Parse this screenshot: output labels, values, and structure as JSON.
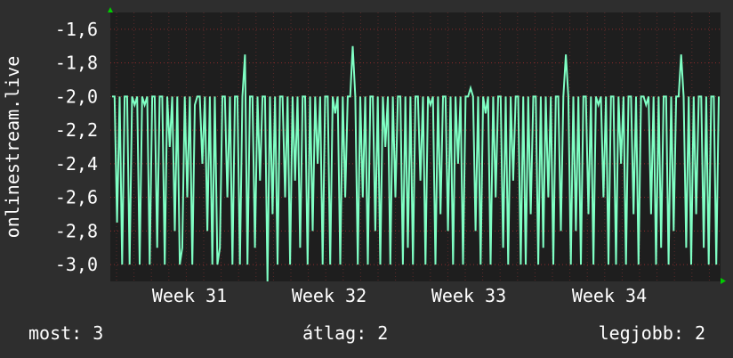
{
  "chart_data": {
    "type": "line",
    "ylabel": "onlinestream.live",
    "ylim": [
      -3.1,
      -1.5
    ],
    "yticks": [
      "-1,6",
      "-1,8",
      "-2,0",
      "-2,2",
      "-2,4",
      "-2,6",
      "-2,8",
      "-3,0"
    ],
    "ytick_values": [
      -1.6,
      -1.8,
      -2.0,
      -2.2,
      -2.4,
      -2.6,
      -2.8,
      -3.0
    ],
    "xticks": [
      "Week 31",
      "Week 32",
      "Week 33",
      "Week 34"
    ],
    "grid": true,
    "colors": {
      "background": "#2e2e2e",
      "plot": "#1e1e1e",
      "line": "#7fffc4",
      "grid": "#8b2b2b",
      "axis_arrow": "#00cc00"
    },
    "series": [
      {
        "values": [
          -2.0,
          -2.0,
          -2.75,
          -2.0,
          -3.0,
          -2.0,
          -2.0,
          -3.0,
          -2.0,
          -2.05,
          -2.0,
          -3.0,
          -2.0,
          -2.05,
          -2.0,
          -3.0,
          -2.0,
          -2.0,
          -2.9,
          -2.0,
          -2.0,
          -3.0,
          -2.0,
          -2.3,
          -2.0,
          -2.8,
          -2.0,
          -3.0,
          -2.9,
          -2.0,
          -2.6,
          -2.0,
          -3.0,
          -2.05,
          -2.0,
          -2.0,
          -2.4,
          -2.0,
          -2.8,
          -2.0,
          -3.0,
          -2.0,
          -3.0,
          -2.9,
          -2.0,
          -2.0,
          -2.6,
          -2.0,
          -3.0,
          -2.0,
          -2.0,
          -3.0,
          -2.0,
          -1.75,
          -3.0,
          -2.0,
          -2.0,
          -2.9,
          -2.0,
          -2.5,
          -2.0,
          -2.0,
          -3.1,
          -2.0,
          -2.7,
          -2.0,
          -3.0,
          -2.0,
          -2.0,
          -2.6,
          -2.0,
          -3.0,
          -2.0,
          -2.5,
          -2.0,
          -2.9,
          -2.0,
          -2.0,
          -3.0,
          -2.0,
          -2.8,
          -2.0,
          -2.4,
          -2.0,
          -3.0,
          -2.0,
          -2.0,
          -3.0,
          -2.0,
          -2.1,
          -2.0,
          -3.0,
          -2.0,
          -2.6,
          -2.0,
          -2.0,
          -1.7,
          -2.0,
          -3.0,
          -2.0,
          -2.6,
          -2.0,
          -3.0,
          -2.0,
          -2.0,
          -2.8,
          -2.0,
          -3.0,
          -2.0,
          -2.3,
          -2.0,
          -3.0,
          -2.0,
          -2.6,
          -2.0,
          -2.0,
          -3.0,
          -2.0,
          -2.9,
          -2.0,
          -3.0,
          -2.0,
          -2.0,
          -2.5,
          -2.0,
          -3.0,
          -2.0,
          -2.05,
          -2.0,
          -3.0,
          -2.0,
          -2.7,
          -2.0,
          -2.0,
          -2.8,
          -2.0,
          -3.0,
          -2.0,
          -2.4,
          -2.0,
          -3.0,
          -2.0,
          -2.0,
          -1.95,
          -2.0,
          -2.8,
          -2.0,
          -3.0,
          -2.0,
          -2.1,
          -2.0,
          -3.0,
          -2.0,
          -2.6,
          -2.0,
          -2.0,
          -2.9,
          -2.0,
          -3.0,
          -2.0,
          -2.5,
          -2.0,
          -2.0,
          -3.0,
          -2.0,
          -3.0,
          -2.0,
          -2.7,
          -2.0,
          -2.0,
          -3.0,
          -2.0,
          -2.9,
          -2.0,
          -2.6,
          -2.0,
          -3.0,
          -2.0,
          -2.0,
          -2.8,
          -2.0,
          -1.75,
          -2.0,
          -3.0,
          -2.0,
          -2.8,
          -2.0,
          -3.0,
          -2.0,
          -2.0,
          -2.7,
          -2.0,
          -3.0,
          -2.0,
          -2.05,
          -2.0,
          -2.6,
          -2.0,
          -3.0,
          -2.0,
          -2.0,
          -3.0,
          -2.0,
          -2.4,
          -2.0,
          -3.0,
          -2.0,
          -2.0,
          -2.7,
          -2.0,
          -3.0,
          -2.0,
          -2.0,
          -2.05,
          -2.0,
          -2.7,
          -2.0,
          -3.0,
          -2.0,
          -2.9,
          -2.0,
          -2.0,
          -3.0,
          -2.0,
          -2.8,
          -2.0,
          -2.0,
          -1.75,
          -2.0,
          -2.9,
          -2.0,
          -3.0,
          -2.0,
          -2.7,
          -2.0,
          -2.0,
          -2.9,
          -2.0,
          -3.0,
          -2.0,
          -2.0,
          -3.0,
          -2.0
        ]
      }
    ]
  },
  "stats": {
    "current": "most: 3",
    "average": "átlag: 2",
    "best": "legjobb: 2"
  }
}
